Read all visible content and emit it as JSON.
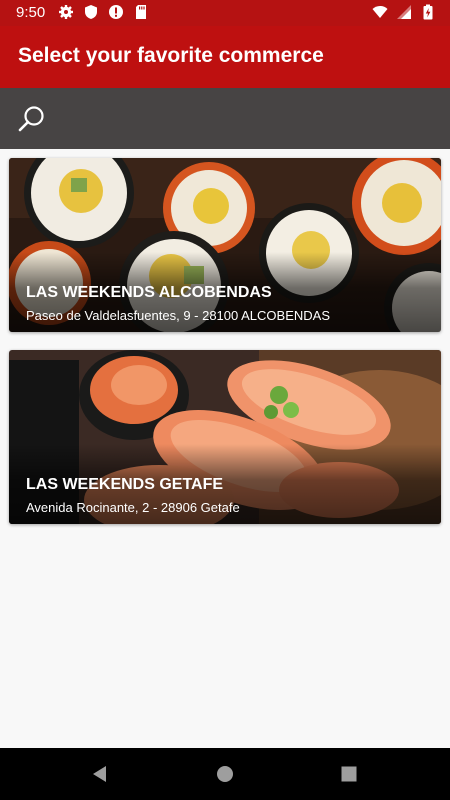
{
  "status_bar": {
    "time": "9:50",
    "left_icons": [
      "gear-icon",
      "shield-icon",
      "alert-icon",
      "sd-card-icon"
    ],
    "right_icons": [
      "wifi-icon",
      "cellular-icon",
      "battery-icon"
    ]
  },
  "app_bar": {
    "title": "Select your favorite commerce",
    "color": "#be1010"
  },
  "search": {
    "icon": "search-icon",
    "bar_color": "#474444"
  },
  "commerces": [
    {
      "name": "LAS WEEKENDS ALCOBENDAS",
      "address": "Paseo de Valdelasfuentes, 9 - 28100 ALCOBENDAS",
      "image": "sushi-rolls-photo"
    },
    {
      "name": "LAS WEEKENDS GETAFE",
      "address": "Avenida Rocinante, 2 - 28906 Getafe",
      "image": "salmon-nigiri-photo"
    }
  ],
  "nav_bar": {
    "buttons": [
      "back-icon",
      "home-icon",
      "recents-icon"
    ]
  }
}
